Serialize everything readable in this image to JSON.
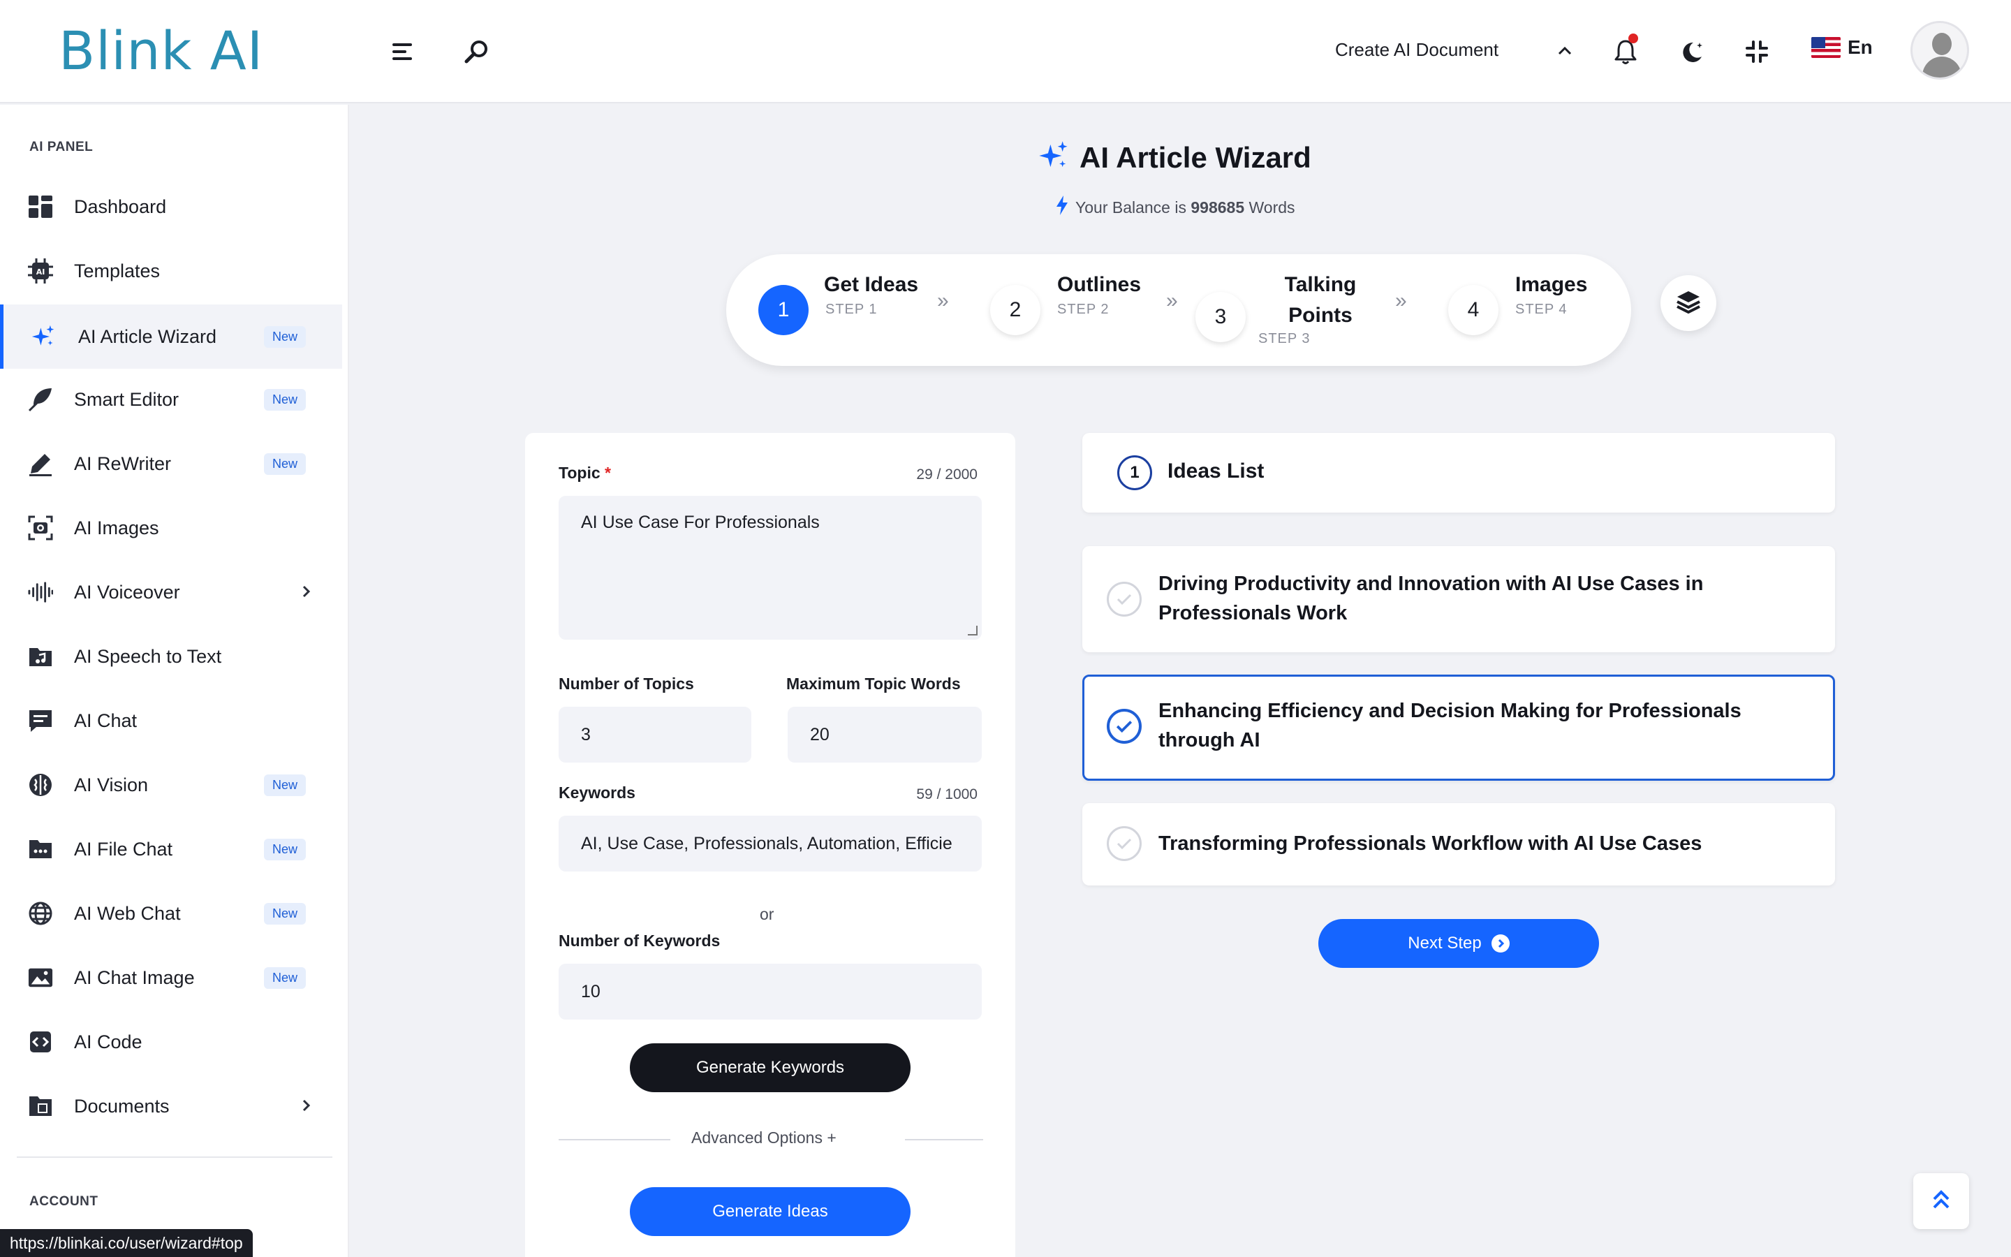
{
  "brand": {
    "logo_text": "Blink AI"
  },
  "header": {
    "create_doc_label": "Create AI Document",
    "language": "En",
    "icons": [
      "menu-icon",
      "search-icon",
      "chevron-up-icon",
      "bell-icon",
      "moon-icon",
      "compress-icon",
      "flag-us-icon",
      "avatar"
    ]
  },
  "sidebar": {
    "section_label": "AI PANEL",
    "account_label": "ACCOUNT",
    "items": [
      {
        "label": "Dashboard",
        "icon": "dashboard-icon",
        "badge": "",
        "chevron": ""
      },
      {
        "label": "Templates",
        "icon": "chip-icon",
        "badge": "",
        "chevron": ""
      },
      {
        "label": "AI Article Wizard",
        "icon": "sparkles-icon",
        "badge": "New",
        "chevron": "",
        "active": true
      },
      {
        "label": "Smart Editor",
        "icon": "feather-icon",
        "badge": "New",
        "chevron": ""
      },
      {
        "label": "AI ReWriter",
        "icon": "pen-icon",
        "badge": "New",
        "chevron": ""
      },
      {
        "label": "AI Images",
        "icon": "camera-icon",
        "badge": "",
        "chevron": ""
      },
      {
        "label": "AI Voiceover",
        "icon": "waveform-icon",
        "badge": "",
        "chevron": "›"
      },
      {
        "label": "AI Speech to Text",
        "icon": "music-folder-icon",
        "badge": "",
        "chevron": ""
      },
      {
        "label": "AI Chat",
        "icon": "chat-icon",
        "badge": "",
        "chevron": ""
      },
      {
        "label": "AI Vision",
        "icon": "brain-icon",
        "badge": "New",
        "chevron": ""
      },
      {
        "label": "AI File Chat",
        "icon": "folder-dots-icon",
        "badge": "New",
        "chevron": ""
      },
      {
        "label": "AI Web Chat",
        "icon": "globe-icon",
        "badge": "New",
        "chevron": ""
      },
      {
        "label": "AI Chat Image",
        "icon": "image-icon",
        "badge": "New",
        "chevron": ""
      },
      {
        "label": "AI Code",
        "icon": "code-icon",
        "badge": "",
        "chevron": ""
      },
      {
        "label": "Documents",
        "icon": "documents-icon",
        "badge": "",
        "chevron": "›"
      }
    ]
  },
  "status_url": "https://blinkai.co/user/wizard#top",
  "page": {
    "title": "AI Article Wizard",
    "balance_prefix": "Your Balance is",
    "balance_value": "998685",
    "balance_suffix": "Words"
  },
  "stepper": {
    "current": 1,
    "steps": [
      {
        "num": "1",
        "title": "Get Ideas",
        "sub": "STEP 1"
      },
      {
        "num": "2",
        "title": "Outlines",
        "sub": "STEP 2"
      },
      {
        "num": "3",
        "title": "Talking Points",
        "title_line1": "Talking",
        "title_line2": "Points",
        "sub": "STEP 3"
      },
      {
        "num": "4",
        "title": "Images",
        "sub": "STEP 4"
      }
    ],
    "arrow": "»"
  },
  "form": {
    "topic_label": "Topic",
    "topic_required": "*",
    "topic_count": "29 / 2000",
    "topic_value": "AI Use Case For Professionals",
    "num_topics_label": "Number of Topics",
    "num_topics_value": "3",
    "max_words_label": "Maximum Topic Words",
    "max_words_value": "20",
    "keywords_label": "Keywords",
    "keywords_count": "59 / 1000",
    "keywords_value": "AI, Use Case, Professionals, Automation, Efficie",
    "or_text": "or",
    "num_keywords_label": "Number of Keywords",
    "num_keywords_value": "10",
    "generate_keywords_label": "Generate Keywords",
    "advanced_label": "Advanced Options +",
    "generate_ideas_label": "Generate Ideas"
  },
  "ideas": {
    "number": "1",
    "title": "Ideas List",
    "items": [
      {
        "text": "Driving Productivity and Innovation with AI Use Cases in Professionals Work",
        "selected": false
      },
      {
        "text": "Enhancing Efficiency and Decision Making for Professionals through AI",
        "selected": true
      },
      {
        "text": "Transforming Professionals Workflow with AI Use Cases",
        "selected": false
      }
    ],
    "next_label": "Next Step"
  },
  "colors": {
    "primary": "#1565ff",
    "dark": "#14161d",
    "logo": "#2b8fb3",
    "background": "#f1f2f6"
  }
}
